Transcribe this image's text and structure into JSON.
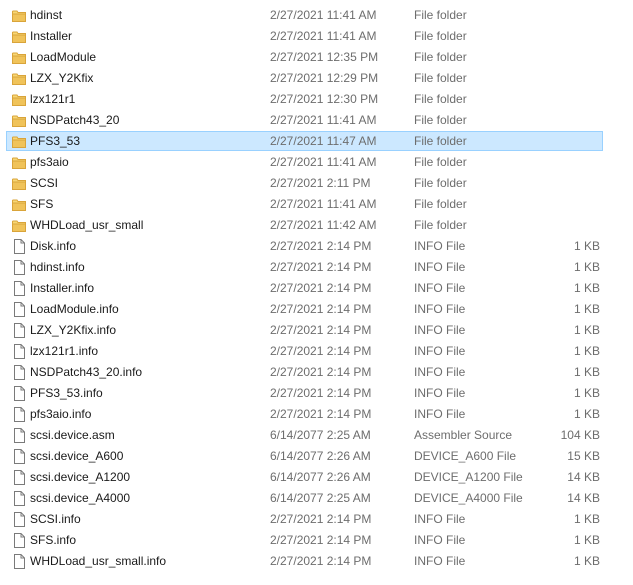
{
  "colors": {
    "selection_bg": "#cce8ff",
    "selection_border": "#99d1ff",
    "folder_icon": "#f0c35a",
    "secondary_text": "#6d6d6d"
  },
  "files": [
    {
      "name": "hdinst",
      "date": "2/27/2021 11:41 AM",
      "type": "File folder",
      "size": "",
      "icon": "folder-icon",
      "selected": false
    },
    {
      "name": "Installer",
      "date": "2/27/2021 11:41 AM",
      "type": "File folder",
      "size": "",
      "icon": "folder-icon",
      "selected": false
    },
    {
      "name": "LoadModule",
      "date": "2/27/2021 12:35 PM",
      "type": "File folder",
      "size": "",
      "icon": "folder-icon",
      "selected": false
    },
    {
      "name": "LZX_Y2Kfix",
      "date": "2/27/2021 12:29 PM",
      "type": "File folder",
      "size": "",
      "icon": "folder-icon",
      "selected": false
    },
    {
      "name": "lzx121r1",
      "date": "2/27/2021 12:30 PM",
      "type": "File folder",
      "size": "",
      "icon": "folder-icon",
      "selected": false
    },
    {
      "name": "NSDPatch43_20",
      "date": "2/27/2021 11:41 AM",
      "type": "File folder",
      "size": "",
      "icon": "folder-icon",
      "selected": false
    },
    {
      "name": "PFS3_53",
      "date": "2/27/2021 11:47 AM",
      "type": "File folder",
      "size": "",
      "icon": "folder-icon",
      "selected": true
    },
    {
      "name": "pfs3aio",
      "date": "2/27/2021 11:41 AM",
      "type": "File folder",
      "size": "",
      "icon": "folder-icon",
      "selected": false
    },
    {
      "name": "SCSI",
      "date": "2/27/2021 2:11 PM",
      "type": "File folder",
      "size": "",
      "icon": "folder-icon",
      "selected": false
    },
    {
      "name": "SFS",
      "date": "2/27/2021 11:41 AM",
      "type": "File folder",
      "size": "",
      "icon": "folder-icon",
      "selected": false
    },
    {
      "name": "WHDLoad_usr_small",
      "date": "2/27/2021 11:42 AM",
      "type": "File folder",
      "size": "",
      "icon": "folder-icon",
      "selected": false
    },
    {
      "name": "Disk.info",
      "date": "2/27/2021 2:14 PM",
      "type": "INFO File",
      "size": "1 KB",
      "icon": "file-icon",
      "selected": false
    },
    {
      "name": "hdinst.info",
      "date": "2/27/2021 2:14 PM",
      "type": "INFO File",
      "size": "1 KB",
      "icon": "file-icon",
      "selected": false
    },
    {
      "name": "Installer.info",
      "date": "2/27/2021 2:14 PM",
      "type": "INFO File",
      "size": "1 KB",
      "icon": "file-icon",
      "selected": false
    },
    {
      "name": "LoadModule.info",
      "date": "2/27/2021 2:14 PM",
      "type": "INFO File",
      "size": "1 KB",
      "icon": "file-icon",
      "selected": false
    },
    {
      "name": "LZX_Y2Kfix.info",
      "date": "2/27/2021 2:14 PM",
      "type": "INFO File",
      "size": "1 KB",
      "icon": "file-icon",
      "selected": false
    },
    {
      "name": "lzx121r1.info",
      "date": "2/27/2021 2:14 PM",
      "type": "INFO File",
      "size": "1 KB",
      "icon": "file-icon",
      "selected": false
    },
    {
      "name": "NSDPatch43_20.info",
      "date": "2/27/2021 2:14 PM",
      "type": "INFO File",
      "size": "1 KB",
      "icon": "file-icon",
      "selected": false
    },
    {
      "name": "PFS3_53.info",
      "date": "2/27/2021 2:14 PM",
      "type": "INFO File",
      "size": "1 KB",
      "icon": "file-icon",
      "selected": false
    },
    {
      "name": "pfs3aio.info",
      "date": "2/27/2021 2:14 PM",
      "type": "INFO File",
      "size": "1 KB",
      "icon": "file-icon",
      "selected": false
    },
    {
      "name": "scsi.device.asm",
      "date": "6/14/2077 2:25 AM",
      "type": "Assembler Source",
      "size": "104 KB",
      "icon": "file-icon",
      "selected": false
    },
    {
      "name": "scsi.device_A600",
      "date": "6/14/2077 2:26 AM",
      "type": "DEVICE_A600 File",
      "size": "15 KB",
      "icon": "file-icon",
      "selected": false
    },
    {
      "name": "scsi.device_A1200",
      "date": "6/14/2077 2:26 AM",
      "type": "DEVICE_A1200 File",
      "size": "14 KB",
      "icon": "file-icon",
      "selected": false
    },
    {
      "name": "scsi.device_A4000",
      "date": "6/14/2077 2:25 AM",
      "type": "DEVICE_A4000 File",
      "size": "14 KB",
      "icon": "file-icon",
      "selected": false
    },
    {
      "name": "SCSI.info",
      "date": "2/27/2021 2:14 PM",
      "type": "INFO File",
      "size": "1 KB",
      "icon": "file-icon",
      "selected": false
    },
    {
      "name": "SFS.info",
      "date": "2/27/2021 2:14 PM",
      "type": "INFO File",
      "size": "1 KB",
      "icon": "file-icon",
      "selected": false
    },
    {
      "name": "WHDLoad_usr_small.info",
      "date": "2/27/2021 2:14 PM",
      "type": "INFO File",
      "size": "1 KB",
      "icon": "file-icon",
      "selected": false
    }
  ]
}
